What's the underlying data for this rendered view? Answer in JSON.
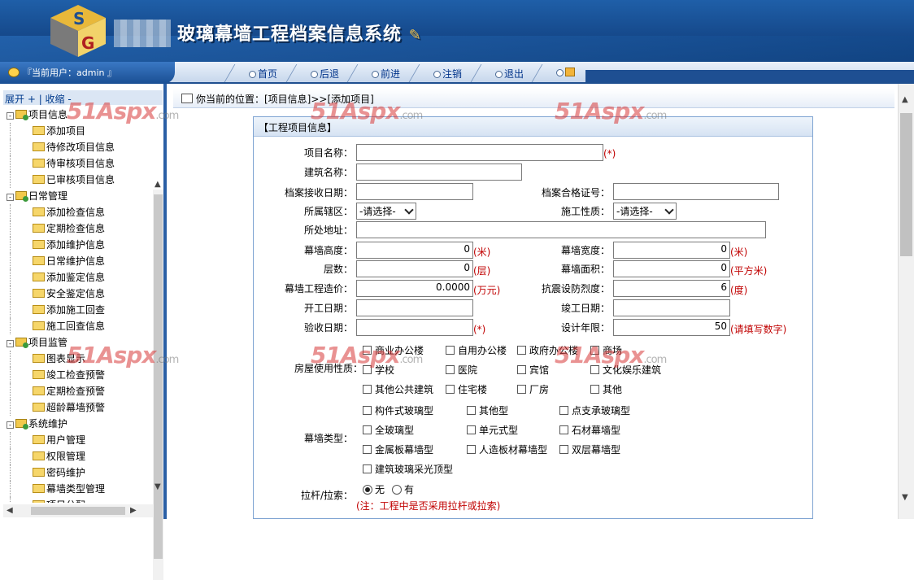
{
  "header": {
    "title": "玻璃幕墙工程档案信息系统",
    "logo_letters": "SG"
  },
  "nav": {
    "user": "『当前用户：admin 』",
    "items": [
      "首页",
      "后退",
      "前进",
      "注销",
      "退出"
    ]
  },
  "sidebar": {
    "expand": "展开 +",
    "sep": " | ",
    "collapse": "收缩 -",
    "groups": [
      {
        "label": "项目信息",
        "items": [
          "添加项目",
          "待修改项目信息",
          "待审核项目信息",
          "已审核项目信息"
        ]
      },
      {
        "label": "日常管理",
        "items": [
          "添加检查信息",
          "定期检查信息",
          "添加维护信息",
          "日常维护信息",
          "添加鉴定信息",
          "安全鉴定信息",
          "添加施工回查",
          "施工回查信息"
        ]
      },
      {
        "label": "项目监管",
        "items": [
          "图表显示",
          "竣工检查预警",
          "定期检查预警",
          "超龄幕墙预警"
        ]
      },
      {
        "label": "系统维护",
        "items": [
          "用户管理",
          "权限管理",
          "密码维护",
          "幕墙类型管理",
          "项目分配"
        ]
      }
    ]
  },
  "breadcrumb": "你当前的位置：[项目信息]>>[添加项目]",
  "watermark": {
    "text": "51Aspx",
    "suffix": ".com"
  },
  "form": {
    "header": "【工程项目信息】",
    "project_name": "项目名称：",
    "required": "(*)",
    "build_name": "建筑名称：",
    "archive_date": "档案接收日期：",
    "cert_no": "档案合格证号：",
    "district": "所属辖区：",
    "district_value": "-请选择-",
    "construction_type": "施工性质：",
    "construction_value": "-请选择-",
    "address": "所处地址：",
    "wall_height": "幕墙高度：",
    "wall_height_value": "0",
    "unit_m": "(米)",
    "wall_width": "幕墙宽度：",
    "wall_width_value": "0",
    "floors": "层数：",
    "floors_value": "0",
    "unit_floor": "(层)",
    "wall_area": "幕墙面积：",
    "wall_area_value": "0",
    "unit_sqm": "(平方米)",
    "cost": "幕墙工程造价：",
    "cost_value": "0.0000",
    "unit_wan": "(万元)",
    "seismic": "抗震设防烈度：",
    "seismic_value": "6",
    "unit_degree": "(度)",
    "start_date": "开工日期：",
    "finish_date": "竣工日期：",
    "accept_date": "验收日期：",
    "design_life": "设计年限：",
    "design_life_value": "50",
    "design_life_hint": "(请填写数字)",
    "usage_label": "房屋使用性质：",
    "usage_options": [
      "商业办公楼",
      "自用办公楼",
      "政府办公楼",
      "商场",
      "学校",
      "医院",
      "宾馆",
      "文化娱乐建筑",
      "其他公共建筑",
      "住宅楼",
      "厂房",
      "其他"
    ],
    "wall_type_label": "幕墙类型：",
    "wall_type_options": [
      "构件式玻璃型",
      "其他型",
      "点支承玻璃型",
      "全玻璃型",
      "单元式型",
      "石材幕墙型",
      "金属板幕墙型",
      "人造板材幕墙型",
      "双层幕墙型",
      "建筑玻璃采光顶型"
    ],
    "rod_label": "拉杆/拉索：",
    "rod_none": "无",
    "rod_yes": "有",
    "rod_note": "(注：工程中是否采用拉杆或拉索)"
  },
  "colors": {
    "banner": "#15488a",
    "accent": "#2a5fa5",
    "hint": "#c00000"
  }
}
